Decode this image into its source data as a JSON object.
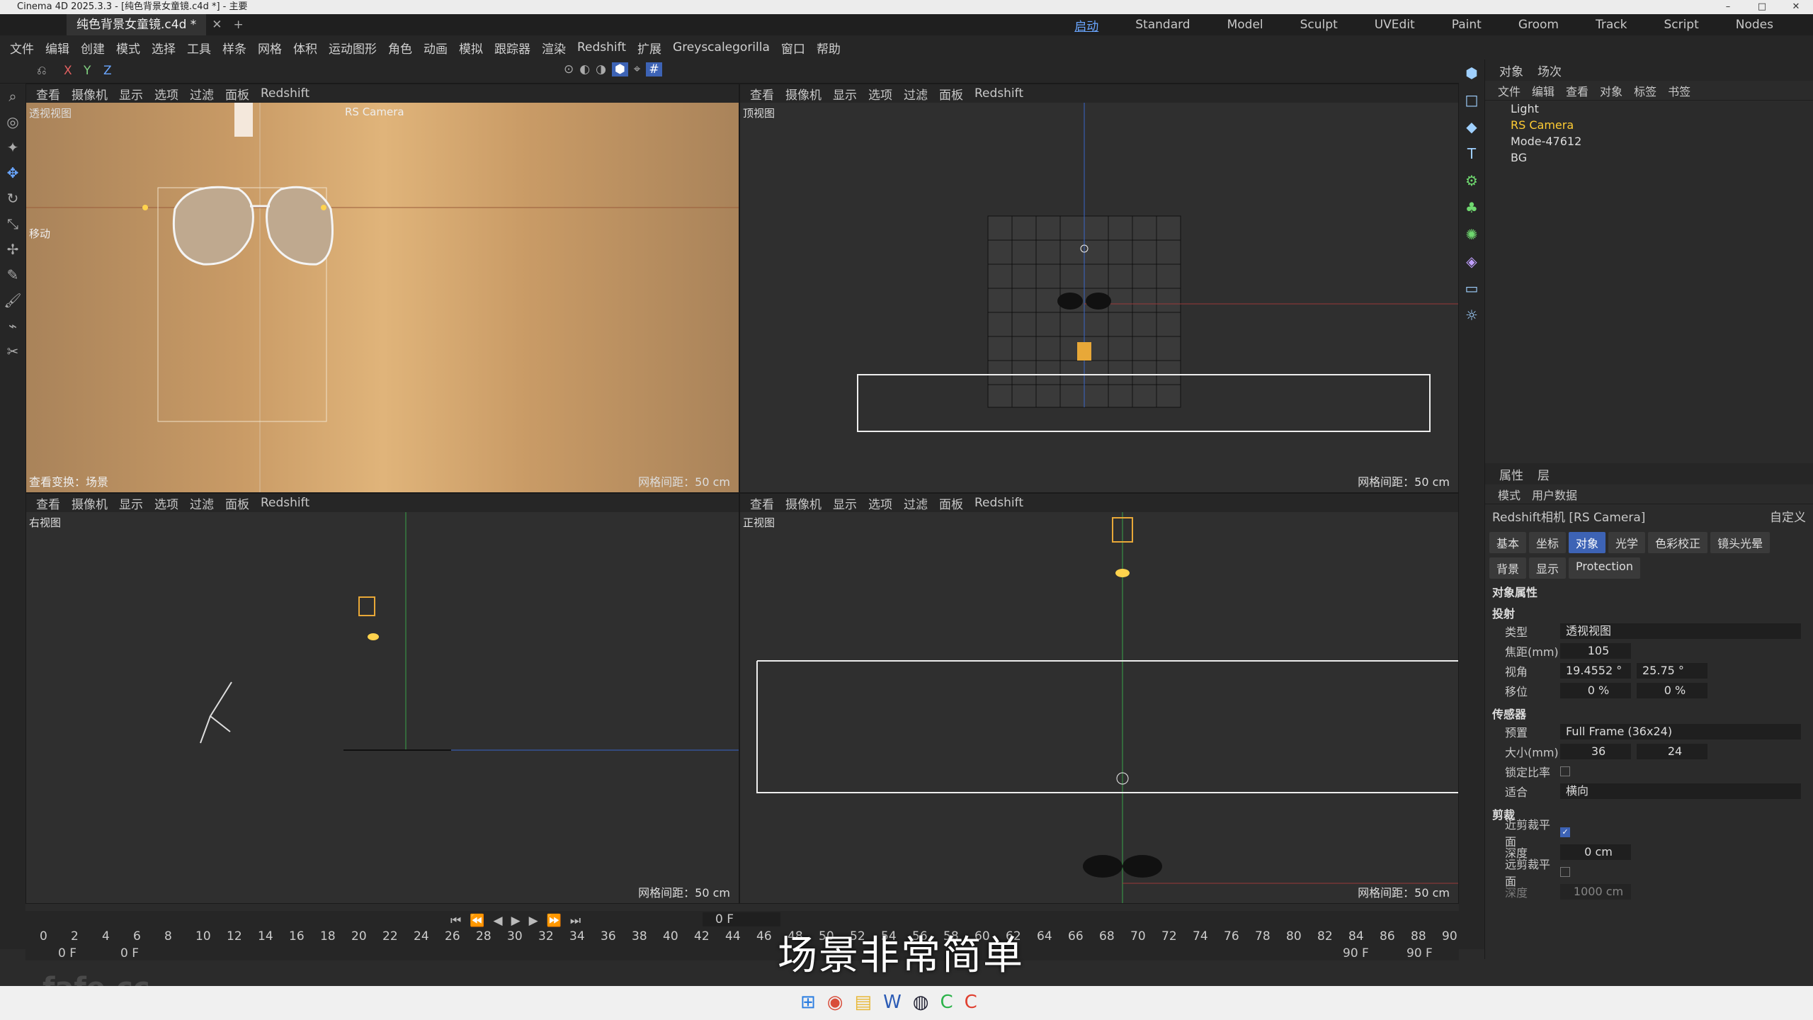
{
  "window": {
    "title": "Cinema 4D 2025.3.3 - [纯色背景女童镜.c4d *] - 主要",
    "doc_tab": "纯色背景女童镜.c4d *"
  },
  "layouts": [
    {
      "label": "启动",
      "active": true
    },
    {
      "label": "Standard"
    },
    {
      "label": "Model"
    },
    {
      "label": "Sculpt"
    },
    {
      "label": "UVEdit"
    },
    {
      "label": "Paint"
    },
    {
      "label": "Groom"
    },
    {
      "label": "Track"
    },
    {
      "label": "Script"
    },
    {
      "label": "Nodes"
    }
  ],
  "menu": [
    "文件",
    "编辑",
    "创建",
    "模式",
    "选择",
    "工具",
    "样条",
    "网格",
    "体积",
    "运动图形",
    "角色",
    "动画",
    "模拟",
    "跟踪器",
    "渲染",
    "Redshift",
    "扩展",
    "Greyscalegorilla",
    "窗口",
    "帮助"
  ],
  "toolbar": {
    "axes": [
      "X",
      "Y",
      "Z"
    ]
  },
  "viewport_menu": [
    "查看",
    "摄像机",
    "显示",
    "选项",
    "过滤",
    "面板",
    "Redshift"
  ],
  "viewports": {
    "perspective": {
      "name": "透视视图",
      "camera": "RS Camera",
      "move": "移动",
      "transform": "查看变换：场景",
      "grid": "网格间距：50 cm"
    },
    "top": {
      "name": "顶视图",
      "grid": "网格间距：50 cm"
    },
    "right": {
      "name": "右视图",
      "grid": "网格间距：50 cm"
    },
    "front": {
      "name": "正视图",
      "grid": "网格间距：50 cm"
    }
  },
  "object_panel": {
    "tabs": [
      "对象",
      "场次"
    ],
    "menu": [
      "文件",
      "编辑",
      "查看",
      "对象",
      "标签",
      "书签"
    ],
    "objects": [
      {
        "name": "Light"
      },
      {
        "name": "RS Camera",
        "selected": true
      },
      {
        "name": "Mode-47612"
      },
      {
        "name": "BG"
      }
    ]
  },
  "attr_panel": {
    "tabs": [
      "属性",
      "层"
    ],
    "menu": [
      "模式",
      "用户数据"
    ],
    "object_title": "Redshift相机 [RS Camera]",
    "preset": "自定义",
    "buttons_row1": [
      {
        "label": "基本"
      },
      {
        "label": "坐标"
      },
      {
        "label": "对象",
        "on": true
      },
      {
        "label": "光学"
      },
      {
        "label": "色彩校正"
      },
      {
        "label": "镜头光晕"
      }
    ],
    "buttons_row2": [
      {
        "label": "背景"
      },
      {
        "label": "显示"
      },
      {
        "label": "Protection"
      }
    ],
    "section_title": "对象属性",
    "projection": {
      "title": "投射",
      "type_label": "类型",
      "type_value": "透视视图",
      "focal_label": "焦距(mm)",
      "focal_value": "105",
      "fov_label": "视角",
      "fov_h": "19.4552 °",
      "fov_v": "25.75 °",
      "shift_label": "移位",
      "shift_x": "0 %",
      "shift_y": "0 %"
    },
    "sensor": {
      "title": "传感器",
      "preset_label": "预置",
      "preset_value": "Full Frame (36x24)",
      "size_label": "大小(mm)",
      "size_w": "36",
      "size_h": "24",
      "lock_label": "锁定比率",
      "fit_label": "适合",
      "fit_value": "横向"
    },
    "clipping": {
      "title": "剪裁",
      "near_label": "近剪裁平面",
      "depth_label": "深度",
      "depth_value": "0 cm",
      "far_label": "远剪裁平面",
      "far_depth_label": "深度",
      "far_depth_value": "1000 cm"
    }
  },
  "timeline": {
    "ticks": [
      "0",
      "2",
      "4",
      "6",
      "8",
      "10",
      "12",
      "14",
      "16",
      "18",
      "20",
      "22",
      "24",
      "26",
      "28",
      "30",
      "32",
      "34",
      "36",
      "38",
      "40",
      "42",
      "44",
      "46",
      "48",
      "50",
      "52",
      "54",
      "56",
      "58",
      "60",
      "62",
      "64",
      "66",
      "68",
      "70",
      "72",
      "74",
      "76",
      "78",
      "80",
      "82",
      "84",
      "86",
      "88",
      "90"
    ],
    "current": "0 F",
    "start": "0 F",
    "start2": "0 F",
    "end": "90 F",
    "end2": "90 F"
  },
  "subtitle": "场景非常简单",
  "watermark": "fafe.cc"
}
